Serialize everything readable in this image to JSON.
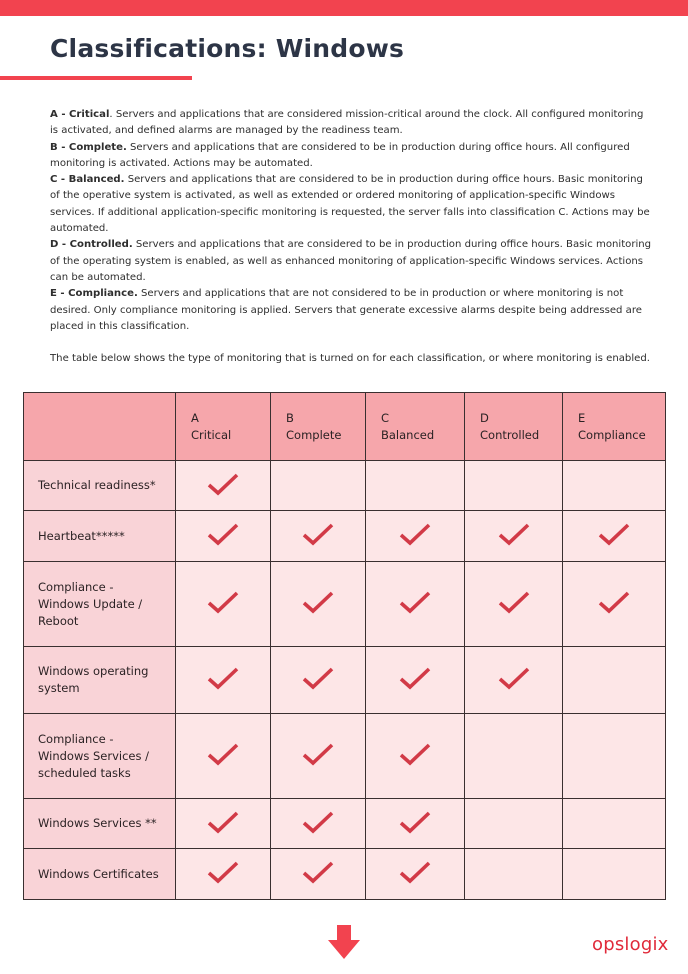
{
  "header": {
    "title": "Classifications: Windows"
  },
  "colors": {
    "accent": "#f2434f",
    "title_text": "#2d3546",
    "header_cell": "#f6a6ab",
    "row_label_cell": "#f9d3d7",
    "body_cell": "#fde6e7",
    "check": "#d23a47",
    "logo": "#e02a3a"
  },
  "intro": {
    "paragraphs": [
      {
        "lead": "A - Critical",
        "text": ". Servers and applications that are considered mission-critical around the clock. All configured monitoring is activated, and defined alarms are managed by the readiness team."
      },
      {
        "lead": "B - Complete.",
        "text": " Servers and applications that are considered to be in production during office hours. All configured monitoring is activated. Actions may be automated."
      },
      {
        "lead": "C - Balanced.",
        "text": " Servers and applications that are considered to be in production during office hours. Basic monitoring of the operative system is activated, as well as extended or ordered monitoring of application-specific Windows services. If additional application-specific monitoring is requested, the server falls into classification C. Actions may be automated."
      },
      {
        "lead": "D - Controlled.",
        "text": " Servers and applications that are considered to be in production during office hours. Basic monitoring of the operating system is enabled, as well as enhanced monitoring of application-specific Windows services. Actions can be automated."
      },
      {
        "lead": "E - Compliance.",
        "text": " Servers and applications that are not considered to be in production or where monitoring is not desired. Only compliance monitoring is applied. Servers that generate excessive alarms despite being addressed are placed in this classification."
      }
    ],
    "table_note": "The table below shows the type of monitoring that is turned on for each classification, or where monitoring is enabled."
  },
  "table": {
    "columns": [
      {
        "letter": "A",
        "name": "Critical"
      },
      {
        "letter": "B",
        "name": "Complete"
      },
      {
        "letter": "C",
        "name": "Balanced"
      },
      {
        "letter": "D",
        "name": "Controlled"
      },
      {
        "letter": "E",
        "name": "Compliance"
      }
    ],
    "rows": [
      {
        "label": "Technical readiness*",
        "checks": [
          true,
          false,
          false,
          false,
          false
        ]
      },
      {
        "label": "Heartbeat*****",
        "checks": [
          true,
          true,
          true,
          true,
          true
        ]
      },
      {
        "label": "Compliance - Windows Update / Reboot",
        "checks": [
          true,
          true,
          true,
          true,
          true
        ]
      },
      {
        "label": "Windows operating system",
        "checks": [
          true,
          true,
          true,
          true,
          false
        ]
      },
      {
        "label": "Compliance - Windows Services / scheduled tasks",
        "checks": [
          true,
          true,
          true,
          false,
          false
        ]
      },
      {
        "label": "Windows Services **",
        "checks": [
          true,
          true,
          true,
          false,
          false
        ]
      },
      {
        "label": "Windows Certificates",
        "checks": [
          true,
          true,
          true,
          false,
          false
        ]
      }
    ],
    "check_icon": "checkmark-icon"
  },
  "footer": {
    "arrow_icon": "down-arrow-icon",
    "logo_text": "opslogix"
  }
}
